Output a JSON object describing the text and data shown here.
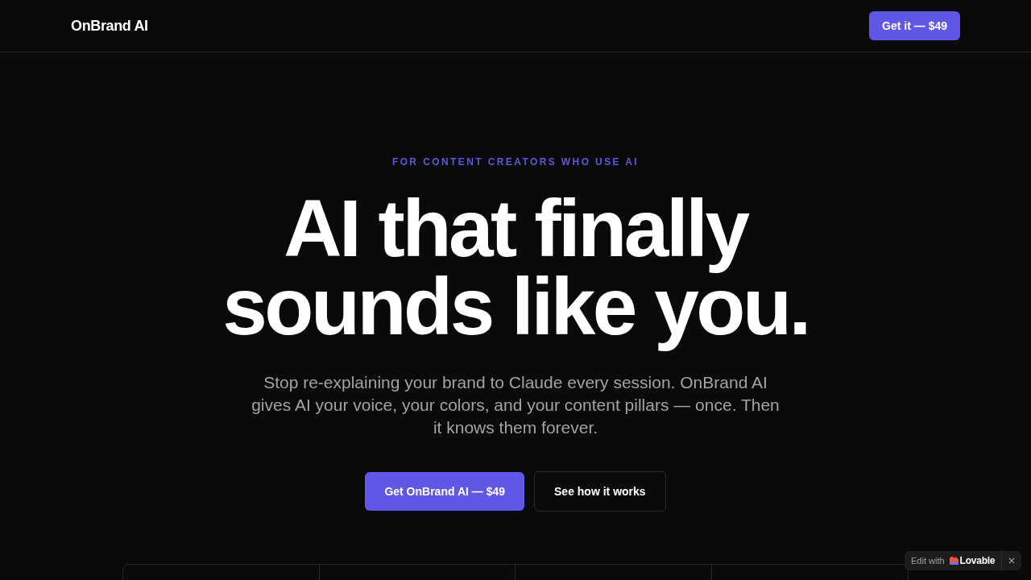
{
  "nav": {
    "logo": "OnBrand AI",
    "cta": "Get it — $49"
  },
  "hero": {
    "eyebrow": "FOR CONTENT CREATORS WHO USE AI",
    "headline_lines": [
      "AI that finally",
      "sounds like you."
    ],
    "description": "Stop re-explaining your brand to Claude every session. OnBrand AI gives AI your voice, your colors, and your content pillars — once. Then it knows them forever.",
    "buttons": [
      {
        "label": "Get OnBrand AI — $49",
        "kind": "primary"
      },
      {
        "label": "See how it works",
        "kind": "secondary"
      }
    ]
  },
  "edit_badge": {
    "prefix": "Edit with",
    "brand": "Lovable"
  }
}
